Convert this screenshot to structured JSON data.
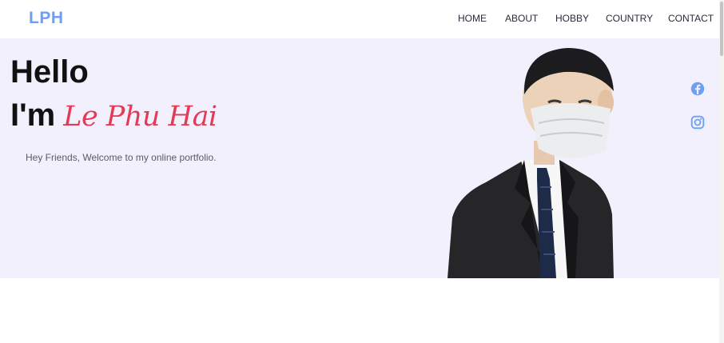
{
  "header": {
    "logo": "LPH",
    "nav": [
      "HOME",
      "ABOUT",
      "HOBBY",
      "COUNTRY",
      "CONTACT"
    ]
  },
  "hero": {
    "greeting": "Hello",
    "intro": "I'm",
    "name": "Le Phu Hai",
    "tagline": "Hey Friends, Welcome to my online portfolio."
  },
  "social": [
    "facebook-icon",
    "instagram-icon"
  ],
  "colors": {
    "accent_logo": "#6f9ff4",
    "name_accent": "#e33a55",
    "hero_background": "#f1f0fc",
    "social_icon": "#6f9ff4"
  }
}
